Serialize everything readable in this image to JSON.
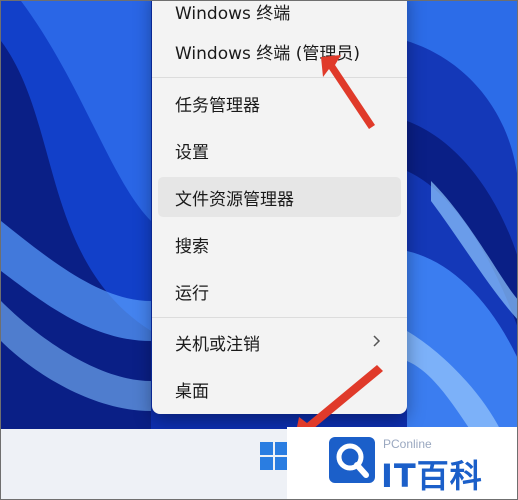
{
  "context_menu": {
    "items": [
      {
        "label": "Windows 终端"
      },
      {
        "label": "Windows 终端 (管理员)"
      },
      {
        "label": "任务管理器"
      },
      {
        "label": "设置"
      },
      {
        "label": "文件资源管理器"
      },
      {
        "label": "搜索"
      },
      {
        "label": "运行"
      },
      {
        "label": "关机或注销",
        "has_submenu": true
      },
      {
        "label": "桌面"
      }
    ],
    "highlighted_item": "文件资源管理器"
  },
  "taskbar": {
    "start_icon": "windows-logo-icon"
  },
  "watermark": {
    "brand_small": "PConline",
    "brand_big": "IT百科",
    "logo_icon": "magnifier-logo-icon"
  },
  "colors": {
    "wallpaper_blue": "#0b2aa8",
    "menu_bg": "#f3f3f3",
    "arrow_red": "#e03a2a",
    "brand_blue": "#1b5fc9"
  }
}
